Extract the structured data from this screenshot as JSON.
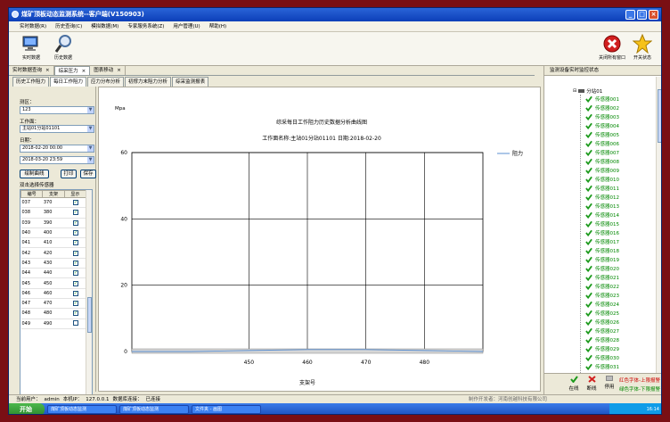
{
  "window": {
    "title": "煤矿顶板动态监测系统--客户端(V150903)"
  },
  "menu": [
    "实时数据(R)",
    "历史查询(C)",
    "模拟数据(M)",
    "专家服务系统(Z)",
    "用户管理(U)",
    "帮助(H)"
  ],
  "toolbar": {
    "realtime": "实时数据",
    "history": "历史数据",
    "close_alarm": "关闭所有窗口",
    "switch_state": "开关状态"
  },
  "doc_tabs": [
    "实时数据查询",
    "综采压力",
    "图表移动"
  ],
  "sub_tabs": [
    "历史工作阻力",
    "每日工作阻力",
    "应力分布分析",
    "初撑力末阻力分析",
    "综采监测报表"
  ],
  "filters": {
    "area_label": "测区：",
    "area_value": "123",
    "face_label": "工作面：",
    "face_value": "主站01分站01101",
    "date_label": "日期：",
    "date_start": "2018-02-20 00:00",
    "date_end": "2018-03-20 23:59",
    "draw_button": "绘制曲线",
    "print_button": "打印",
    "save_button": "保存",
    "select_hint": "双击选择传感器"
  },
  "sensor_table": {
    "headers": [
      "编号",
      "支架",
      "显示"
    ],
    "rows": [
      {
        "id": "037",
        "support": "370",
        "checked": true
      },
      {
        "id": "038",
        "support": "380",
        "checked": true
      },
      {
        "id": "039",
        "support": "390",
        "checked": true
      },
      {
        "id": "040",
        "support": "400",
        "checked": true
      },
      {
        "id": "041",
        "support": "410",
        "checked": true
      },
      {
        "id": "042",
        "support": "420",
        "checked": true
      },
      {
        "id": "043",
        "support": "430",
        "checked": true
      },
      {
        "id": "044",
        "support": "440",
        "checked": true
      },
      {
        "id": "045",
        "support": "450",
        "checked": true
      },
      {
        "id": "046",
        "support": "460",
        "checked": true
      },
      {
        "id": "047",
        "support": "470",
        "checked": true
      },
      {
        "id": "048",
        "support": "480",
        "checked": true
      },
      {
        "id": "049",
        "support": "490",
        "checked": false
      }
    ]
  },
  "chart_data": {
    "type": "line",
    "title": "综采每日工作阻力历史数据分析曲线图",
    "subtitle": "工作面名称:主站01分站01101 日期:2018-02-20",
    "ylabel": "Mpa",
    "xlabel": "支架号",
    "ylim": [
      0,
      60
    ],
    "yticks": [
      0,
      20,
      40,
      60
    ],
    "xlim": [
      430,
      490
    ],
    "xticks": [
      450,
      460,
      470,
      480
    ],
    "grid": true,
    "legend_position": "top-right",
    "series": [
      {
        "name": "阻力",
        "color": "#5b8fd0",
        "x": [
          430,
          440,
          450,
          460,
          470,
          480,
          490
        ],
        "y": [
          0,
          0,
          0.3,
          0.6,
          0.6,
          0.3,
          0
        ]
      }
    ]
  },
  "right_panel": {
    "title": "监测设备实时监控状态",
    "root": "分站01",
    "sensors": [
      "传感器001",
      "传感器002",
      "传感器003",
      "传感器004",
      "传感器005",
      "传感器006",
      "传感器007",
      "传感器008",
      "传感器009",
      "传感器010",
      "传感器011",
      "传感器012",
      "传感器013",
      "传感器014",
      "传感器015",
      "传感器016",
      "传感器017",
      "传感器018",
      "传感器019",
      "传感器020",
      "传感器021",
      "传感器022",
      "传感器023",
      "传感器024",
      "传感器025",
      "传感器026",
      "传感器027",
      "传感器028",
      "传感器029",
      "传感器030",
      "传感器031"
    ],
    "legend": {
      "online": "在线",
      "offline": "断线",
      "disabled": "停用",
      "red_upper": "红色字体-上限报警",
      "green_lower": "绿色字体-下限报警"
    }
  },
  "statusbar": {
    "user_label": "当前用户：",
    "user": "admin",
    "ip_label": "本机IP：",
    "ip": "127.0.0.1",
    "db_label": "数据库连接：",
    "db": "已连接",
    "company": "制作开发者：河南创越科技有限公司"
  },
  "taskbar": {
    "start": "开始",
    "tasks": [
      "煤矿顶板动态监测",
      "煤矿顶板动态监测",
      "文件夹 - 画图"
    ],
    "clock": "16:14"
  }
}
